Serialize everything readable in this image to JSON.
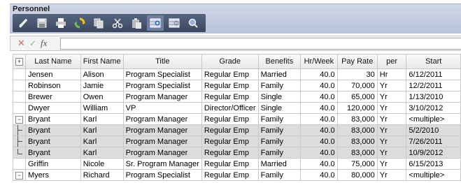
{
  "window": {
    "title": "Personnel"
  },
  "toolbar": {
    "buttons": [
      {
        "icon": "pencil-icon"
      },
      {
        "icon": "save-icon"
      },
      {
        "icon": "print-icon"
      },
      {
        "icon": "refresh-icon"
      },
      {
        "icon": "copy-icon"
      },
      {
        "icon": "cut-icon"
      },
      {
        "icon": "paste-icon"
      },
      {
        "icon": "add-row-icon"
      },
      {
        "icon": "delete-row-icon"
      },
      {
        "icon": "search-icon"
      }
    ]
  },
  "formula": {
    "cancel": "✕",
    "accept": "✓",
    "fx": "fx",
    "value": ""
  },
  "grid": {
    "columns": [
      "",
      "Last Name",
      "First Name",
      "Title",
      "Grade",
      "Benefits",
      "Hr/Week",
      "Pay Rate",
      "per",
      "Start"
    ],
    "rows": [
      {
        "type": "normal",
        "exp": "",
        "last": "Jensen",
        "first": "Alison",
        "title": "Program Specialist",
        "grade": "Regular Emp",
        "benefits": "Married",
        "hr": "40.0",
        "pay": "30",
        "per": "Hr",
        "start": "6/12/2011"
      },
      {
        "type": "normal",
        "exp": "",
        "last": "Robinson",
        "first": "Jamie",
        "title": "Program Specialist",
        "grade": "Regular Emp",
        "benefits": "Family",
        "hr": "40.0",
        "pay": "70,000",
        "per": "Yr",
        "start": "12/2/2011"
      },
      {
        "type": "normal",
        "exp": "",
        "last": "Brewer",
        "first": "Owen",
        "title": "Program Manager",
        "grade": "Regular Emp",
        "benefits": "Single",
        "hr": "40.0",
        "pay": "65,000",
        "per": "Yr",
        "start": "1/13/2010"
      },
      {
        "type": "normal",
        "exp": "",
        "last": "Dwyer",
        "first": "William",
        "title": "VP",
        "grade": "Director/Officer",
        "benefits": "Single",
        "hr": "40.0",
        "pay": "120,000",
        "per": "Yr",
        "start": "3/10/2012"
      },
      {
        "type": "group",
        "exp": "−",
        "last": "Bryant",
        "first": "Karl",
        "title": "Program Manager",
        "grade": "Regular Emp",
        "benefits": "Family",
        "hr": "40.0",
        "pay": "83,000",
        "per": "Yr",
        "start": "<multiple>"
      },
      {
        "type": "sub",
        "exp": "tree",
        "last": "Bryant",
        "first": "Karl",
        "title": "Program Manager",
        "grade": "Regular Emp",
        "benefits": "Family",
        "hr": "40.0",
        "pay": "83,000",
        "per": "Yr",
        "start": "5/2/2010"
      },
      {
        "type": "sub",
        "exp": "tree",
        "last": "Bryant",
        "first": "Karl",
        "title": "Program Manager",
        "grade": "Regular Emp",
        "benefits": "Family",
        "hr": "40.0",
        "pay": "83,000",
        "per": "Yr",
        "start": "7/26/2011"
      },
      {
        "type": "sub",
        "exp": "tree-last",
        "last": "Bryant",
        "first": "Karl",
        "title": "Program Manager",
        "grade": "Regular Emp",
        "benefits": "Family",
        "hr": "40.0",
        "pay": "83,000",
        "per": "Yr",
        "start": "10/9/2012"
      },
      {
        "type": "normal",
        "exp": "",
        "last": "Griffin",
        "first": "Nicole",
        "title": "Sr. Program Manager",
        "grade": "Regular Emp",
        "benefits": "Married",
        "hr": "40.0",
        "pay": "75,000",
        "per": "Yr",
        "start": "6/15/2013"
      },
      {
        "type": "group",
        "exp": "−",
        "last": "Myers",
        "first": "Richard",
        "title": "Program Specialist",
        "grade": "Regular Emp",
        "benefits": "Family",
        "hr": "40.0",
        "pay": "80,000",
        "per": "Yr",
        "start": "<multiple>"
      }
    ]
  },
  "colors": {
    "toolbar_bg": "#46536c",
    "panel_bg": "#c4cde0",
    "sub_row_bg": "#dcdcdc"
  }
}
